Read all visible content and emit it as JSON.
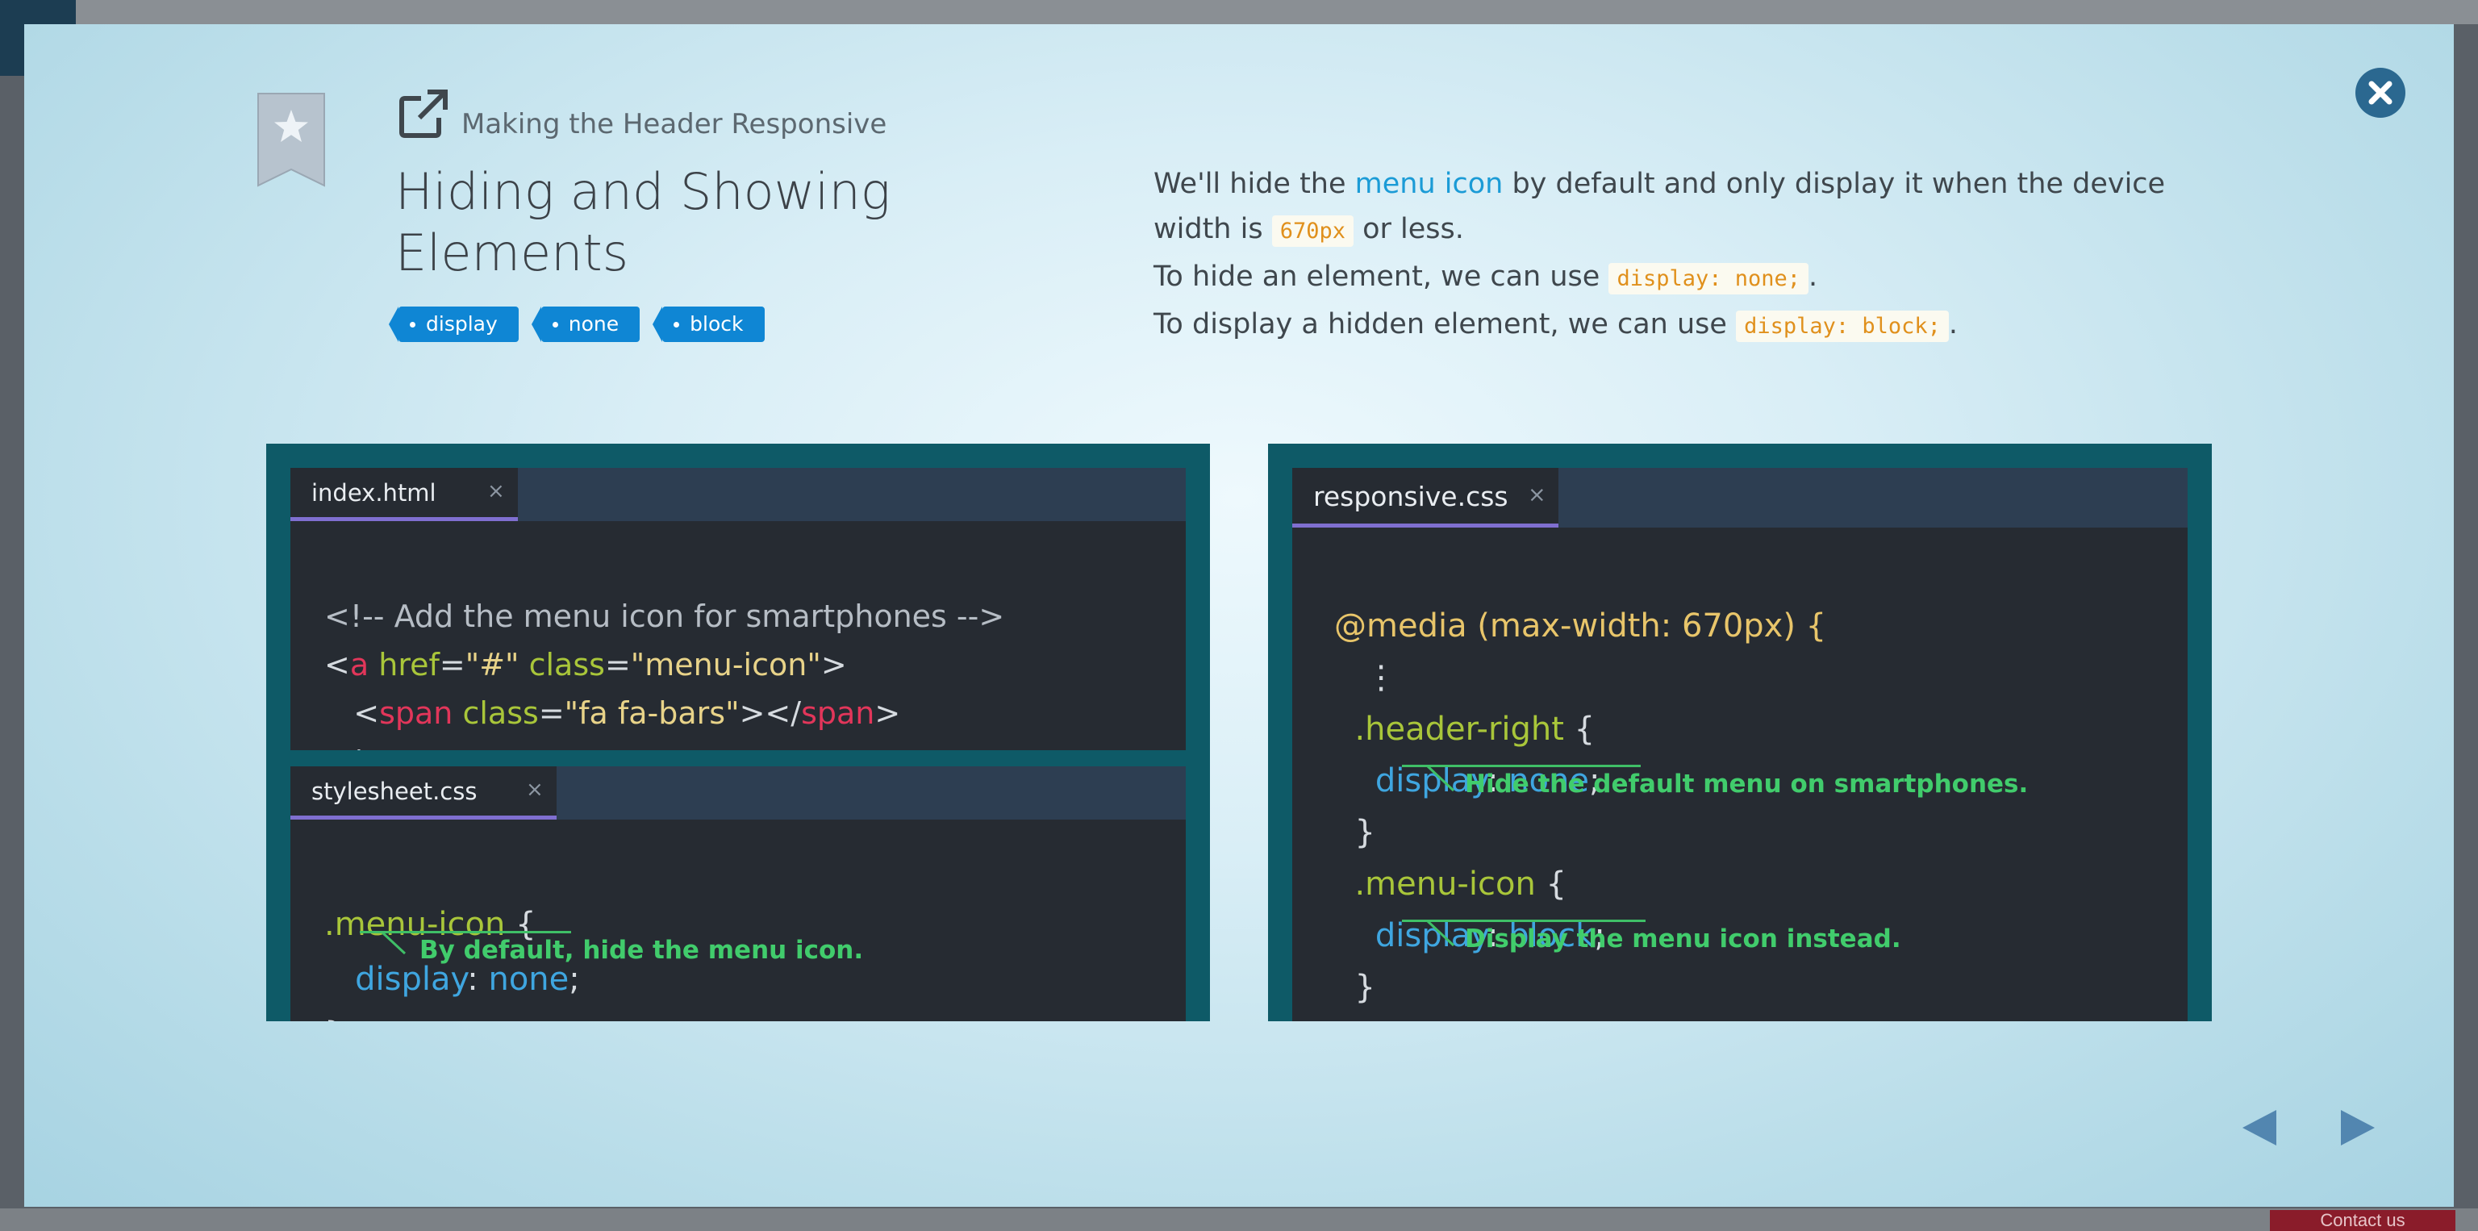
{
  "background": {
    "contact_label": "Contact us"
  },
  "modal": {
    "section_title": "Making the Header Responsive",
    "title": "Hiding and Showing Elements",
    "tags": [
      "display",
      "none",
      "block"
    ],
    "description": {
      "line1_pre": "We'll hide the ",
      "line1_link": "menu icon",
      "line1_post": " by default and only display it when the device width is ",
      "line1_code": "670px",
      "line1_end": " or less.",
      "line2_pre": "To hide an element, we can use ",
      "line2_code": "display: none;",
      "line2_end": ".",
      "line3_pre": "To display a hidden element, we can use ",
      "line3_code": "display: block;",
      "line3_end": "."
    }
  },
  "editors": {
    "html": {
      "tab": "index.html",
      "close": "×",
      "comment": "<!-- Add the menu icon for smartphones -->"
    },
    "css": {
      "tab": "stylesheet.css",
      "close": "×",
      "selector": ".menu-icon",
      "prop": "display",
      "value": "none",
      "note": "By default, hide the menu icon."
    },
    "responsive": {
      "tab": "responsive.css",
      "close": "×",
      "media": "@media (max-width: 670px) {",
      "ellipsis": "⋮",
      "sel1": ".header-right",
      "prop1": "display",
      "val1": "none",
      "note1": "Hide the default menu on smartphones.",
      "sel2": ".menu-icon",
      "prop2": "display",
      "val2": "block",
      "note2": "Display the menu icon instead."
    }
  },
  "colors": {
    "accent": "#0f86d4",
    "close": "#2b6890",
    "panel": "#0e5a67",
    "editor": "#262b32",
    "note": "#41cc6c"
  }
}
